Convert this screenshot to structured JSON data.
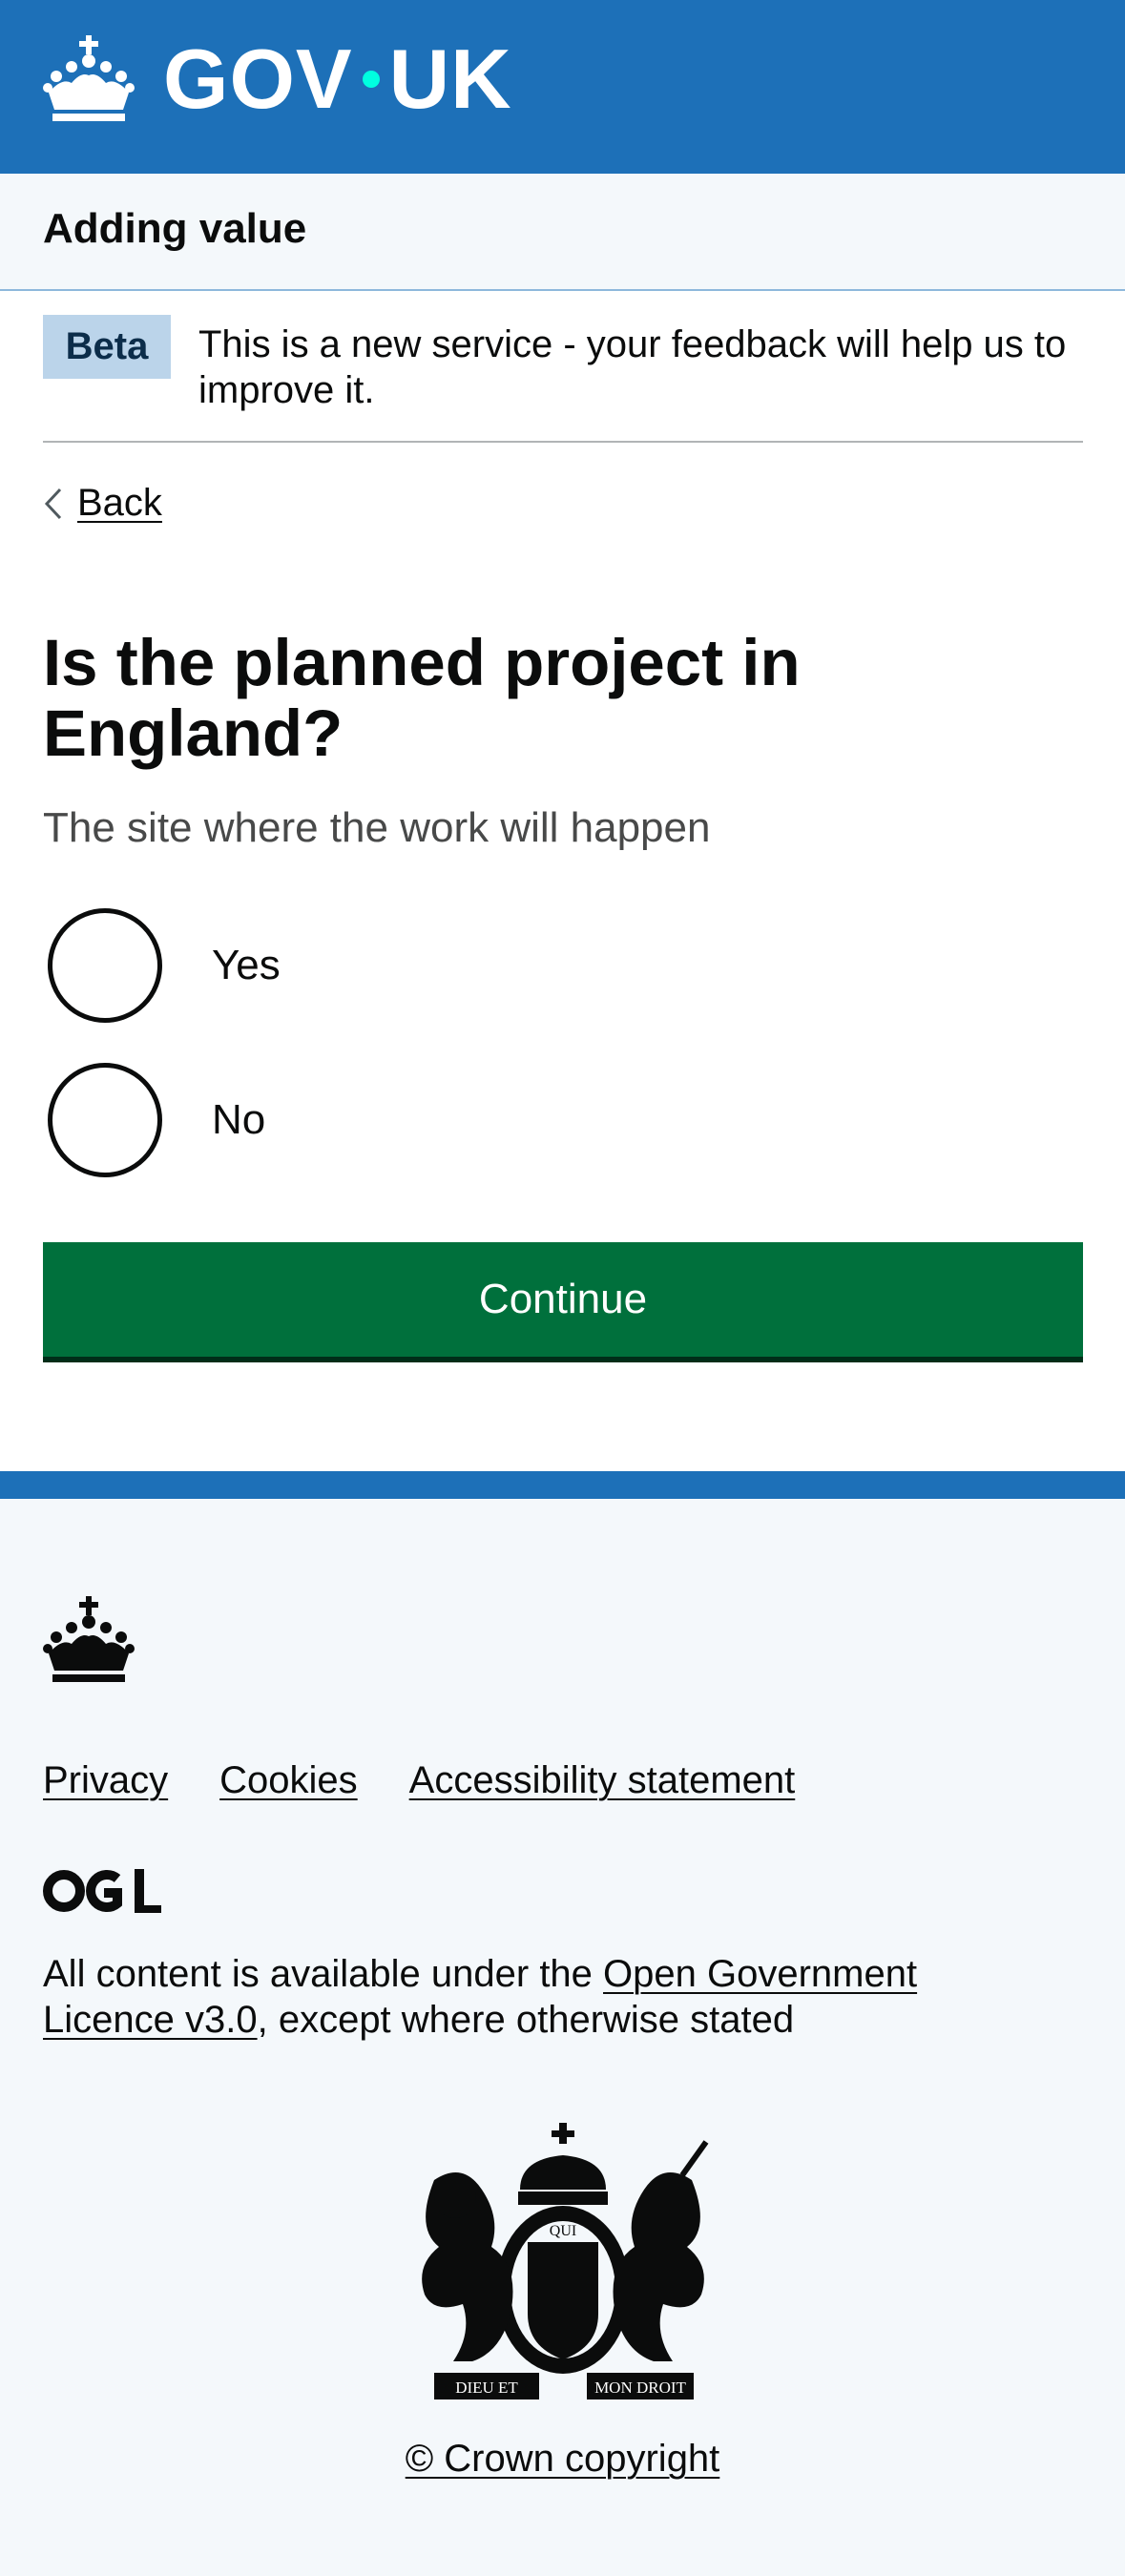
{
  "header": {
    "logo_text_left": "GOV",
    "logo_text_right": "UK",
    "logo_icon": "crown-icon",
    "background_color": "#1d70b8"
  },
  "service": {
    "name": "Adding value"
  },
  "phase_banner": {
    "tag": "Beta",
    "text": "This is a new service - your feedback will help us to improve it."
  },
  "back_link": {
    "label": "Back",
    "icon": "chevron-left-icon"
  },
  "question": {
    "heading": "Is the planned project in England?",
    "hint": "The site where the work will happen",
    "options": [
      {
        "label": "Yes",
        "selected": false
      },
      {
        "label": "No",
        "selected": false
      }
    ]
  },
  "actions": {
    "continue_label": "Continue",
    "button_color": "#00703c"
  },
  "footer": {
    "links": [
      "Privacy",
      "Cookies",
      "Accessibility statement"
    ],
    "ogl_logo_text": "OGL",
    "licence_prefix": "All content is available under the ",
    "licence_link": "Open Government Licence v3.0",
    "licence_suffix": ", except where otherwise stated",
    "coat_of_arms_left_text": "DIEU ET",
    "coat_of_arms_right_text": "MON DROIT",
    "coat_of_arms_top_text": "QUI",
    "copyright": "© Crown copyright"
  }
}
